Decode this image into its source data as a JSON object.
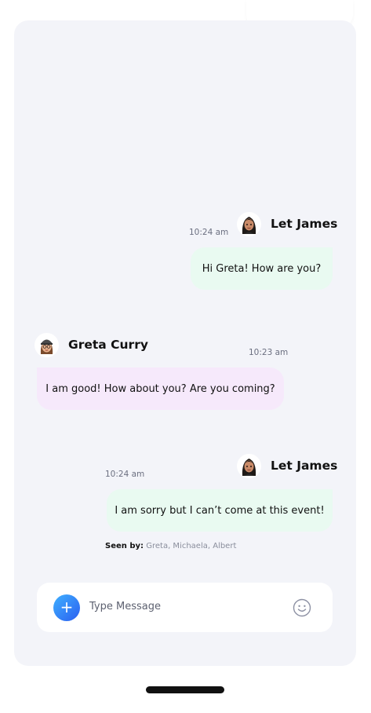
{
  "messages": [
    {
      "sender": "Let James",
      "time": "10:24 am",
      "text": "Hi Greta! How are you?",
      "direction": "outgoing"
    },
    {
      "sender": "Greta Curry",
      "time": "10:23 am",
      "text": "I am good! How about you? Are you coming?",
      "direction": "incoming"
    },
    {
      "sender": "Let James",
      "time": "10:24 am",
      "text": "I am sorry but I can’t come at this event!",
      "direction": "outgoing"
    }
  ],
  "seen": {
    "label": "Seen by:",
    "names": "Greta, Michaela, Albert"
  },
  "composer": {
    "add_icon": "plus-icon",
    "add_label": "+",
    "placeholder": "Type Message",
    "emoji_icon": "smiley-icon"
  },
  "colors": {
    "outgoing_bubble": "#e9faf1",
    "incoming_bubble": "#f6e9fb",
    "panel": "#f3f4f9",
    "send_gradient": [
      "#3fb0ff",
      "#2b5ff0"
    ]
  }
}
